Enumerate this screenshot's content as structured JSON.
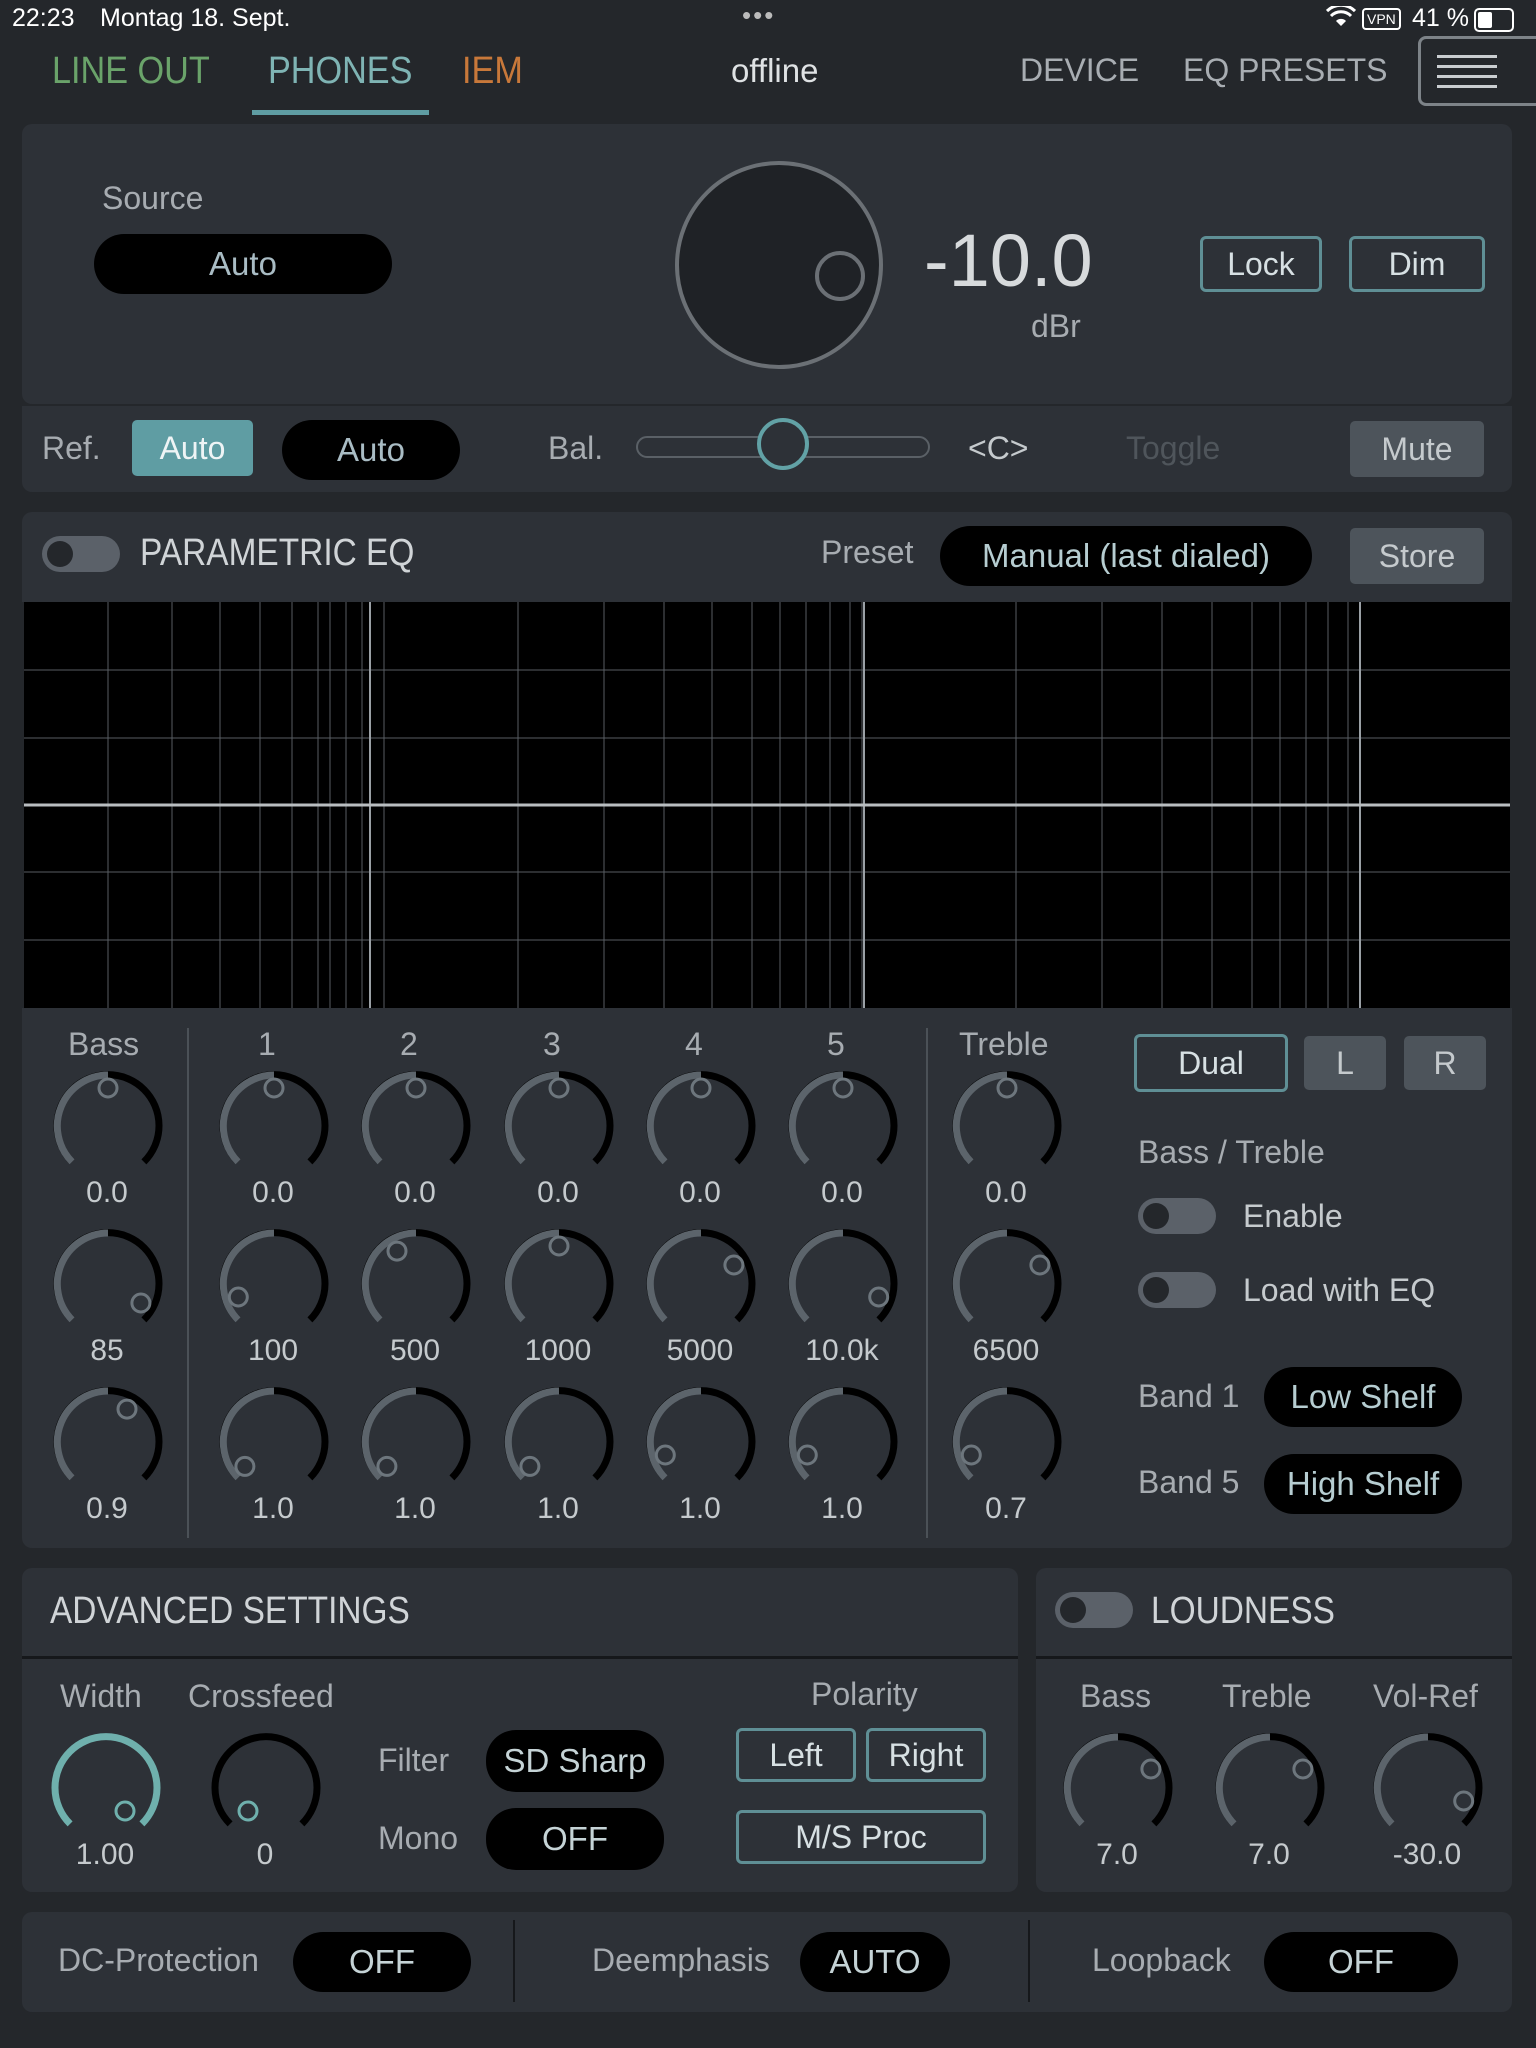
{
  "status": {
    "time": "22:23",
    "date": "Montag 18. Sept.",
    "dots": "•••",
    "vpn": "VPN",
    "battery": "41 %"
  },
  "nav": {
    "tabs": [
      {
        "label": "LINE OUT",
        "color": "#6aa36a"
      },
      {
        "label": "PHONES",
        "color": "#7fb4b4"
      },
      {
        "label": "IEM",
        "color": "#c8783a"
      }
    ],
    "status": "offline",
    "device": "DEVICE",
    "eq_presets": "EQ PRESETS"
  },
  "volume": {
    "source_label": "Source",
    "source_value": "Auto",
    "value": "-10.0",
    "unit": "dBr",
    "lock": "Lock",
    "dim": "Dim"
  },
  "refbar": {
    "ref_label": "Ref.",
    "ref_btn": "Auto",
    "ref_pill": "Auto",
    "bal_label": "Bal.",
    "bal_value": "<C>",
    "bal_position": 0.5,
    "toggle": "Toggle",
    "mute": "Mute"
  },
  "peq": {
    "title": "PARAMETRIC EQ",
    "preset_label": "Preset",
    "preset_value": "Manual (last dialed)",
    "store": "Store"
  },
  "eq": {
    "bands": [
      {
        "name": "Bass",
        "gain": "0.0",
        "freq": "85",
        "q": "0.9"
      },
      {
        "name": "1",
        "gain": "0.0",
        "freq": "100",
        "q": "1.0"
      },
      {
        "name": "2",
        "gain": "0.0",
        "freq": "500",
        "q": "1.0"
      },
      {
        "name": "3",
        "gain": "0.0",
        "freq": "1000",
        "q": "1.0"
      },
      {
        "name": "4",
        "gain": "0.0",
        "freq": "5000",
        "q": "1.0"
      },
      {
        "name": "5",
        "gain": "0.0",
        "freq": "10.0k",
        "q": "1.0"
      },
      {
        "name": "Treble",
        "gain": "0.0",
        "freq": "6500",
        "q": "0.7"
      }
    ],
    "dual": "Dual",
    "l": "L",
    "r": "R",
    "bt_title": "Bass / Treble",
    "enable": "Enable",
    "load_with_eq": "Load with EQ",
    "band1_label": "Band 1",
    "band1_value": "Low Shelf",
    "band5_label": "Band 5",
    "band5_value": "High Shelf"
  },
  "advanced": {
    "title": "ADVANCED SETTINGS",
    "width_label": "Width",
    "width_value": "1.00",
    "crossfeed_label": "Crossfeed",
    "crossfeed_value": "0",
    "filter_label": "Filter",
    "filter_value": "SD Sharp",
    "mono_label": "Mono",
    "mono_value": "OFF",
    "polarity_label": "Polarity",
    "left": "Left",
    "right": "Right",
    "ms": "M/S Proc"
  },
  "loudness": {
    "title": "LOUDNESS",
    "bass_label": "Bass",
    "bass_value": "7.0",
    "treble_label": "Treble",
    "treble_value": "7.0",
    "volref_label": "Vol-Ref",
    "volref_value": "-30.0"
  },
  "bottom": {
    "dc_label": "DC-Protection",
    "dc_value": "OFF",
    "de_label": "Deemphasis",
    "de_value": "AUTO",
    "lb_label": "Loopback",
    "lb_value": "OFF"
  }
}
